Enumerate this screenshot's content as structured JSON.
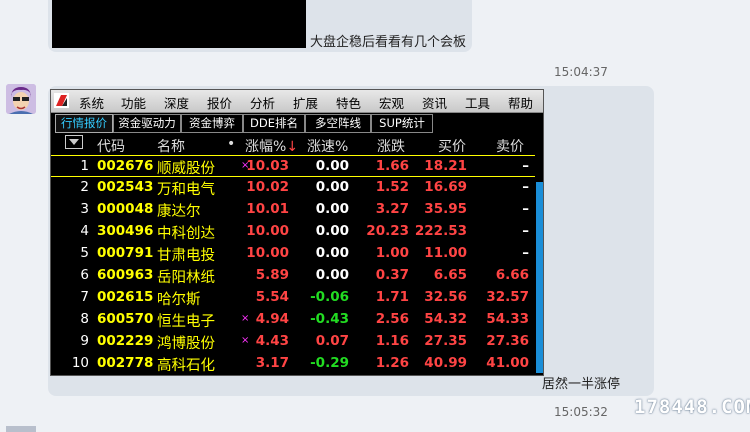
{
  "chat": {
    "msg1_text": "大盘企稳后看看有几个会板",
    "time1": "15:04:37",
    "msg2_text": "居然一半涨停",
    "time2": "15:05:32"
  },
  "menu": [
    "系统",
    "功能",
    "深度",
    "报价",
    "分析",
    "扩展",
    "特色",
    "宏观",
    "资讯",
    "工具",
    "帮助"
  ],
  "tabs": [
    "行情报价",
    "资金驱动力",
    "资金博弈",
    "DDE排名",
    "多空阵线",
    "SUP统计"
  ],
  "columns": {
    "code": "代码",
    "name": "名称",
    "dot": "•",
    "change_pct": "涨幅%",
    "speed": "涨速%",
    "change": "涨跌",
    "bid": "买价",
    "ask": "卖价"
  },
  "rows": [
    {
      "idx": "1",
      "code": "002676",
      "name": "顺威股份",
      "flag": "×",
      "change_pct": "10.03",
      "speed": "0.00",
      "change": "1.66",
      "bid": "18.21",
      "ask": "–"
    },
    {
      "idx": "2",
      "code": "002543",
      "name": "万和电气",
      "flag": "",
      "change_pct": "10.02",
      "speed": "0.00",
      "change": "1.52",
      "bid": "16.69",
      "ask": "–"
    },
    {
      "idx": "3",
      "code": "000048",
      "name": "康达尔",
      "flag": "",
      "change_pct": "10.01",
      "speed": "0.00",
      "change": "3.27",
      "bid": "35.95",
      "ask": "–"
    },
    {
      "idx": "4",
      "code": "300496",
      "name": "中科创达",
      "flag": "",
      "change_pct": "10.00",
      "speed": "0.00",
      "change": "20.23",
      "bid": "222.53",
      "ask": "–"
    },
    {
      "idx": "5",
      "code": "000791",
      "name": "甘肃电投",
      "flag": "",
      "change_pct": "10.00",
      "speed": "0.00",
      "change": "1.00",
      "bid": "11.00",
      "ask": "–"
    },
    {
      "idx": "6",
      "code": "600963",
      "name": "岳阳林纸",
      "flag": "",
      "change_pct": "5.89",
      "speed": "0.00",
      "change": "0.37",
      "bid": "6.65",
      "ask": "6.66"
    },
    {
      "idx": "7",
      "code": "002615",
      "name": "哈尔斯",
      "flag": "",
      "change_pct": "5.54",
      "speed": "-0.06",
      "change": "1.71",
      "bid": "32.56",
      "ask": "32.57"
    },
    {
      "idx": "8",
      "code": "600570",
      "name": "恒生电子",
      "flag": "×",
      "change_pct": "4.94",
      "speed": "-0.43",
      "change": "2.56",
      "bid": "54.32",
      "ask": "54.33"
    },
    {
      "idx": "9",
      "code": "002229",
      "name": "鸿博股份",
      "flag": "×",
      "change_pct": "4.43",
      "speed": "0.07",
      "change": "1.16",
      "bid": "27.35",
      "ask": "27.36"
    },
    {
      "idx": "10",
      "code": "002778",
      "name": "高科石化",
      "flag": "",
      "change_pct": "3.17",
      "speed": "-0.29",
      "change": "1.26",
      "bid": "40.99",
      "ask": "41.00"
    }
  ],
  "watermark": "178448.COM",
  "colors": {
    "up": "#ff4444",
    "down": "#22dd22",
    "neutral": "#ffffff",
    "code": "#ffff00",
    "accent": "#1a8ed8"
  }
}
